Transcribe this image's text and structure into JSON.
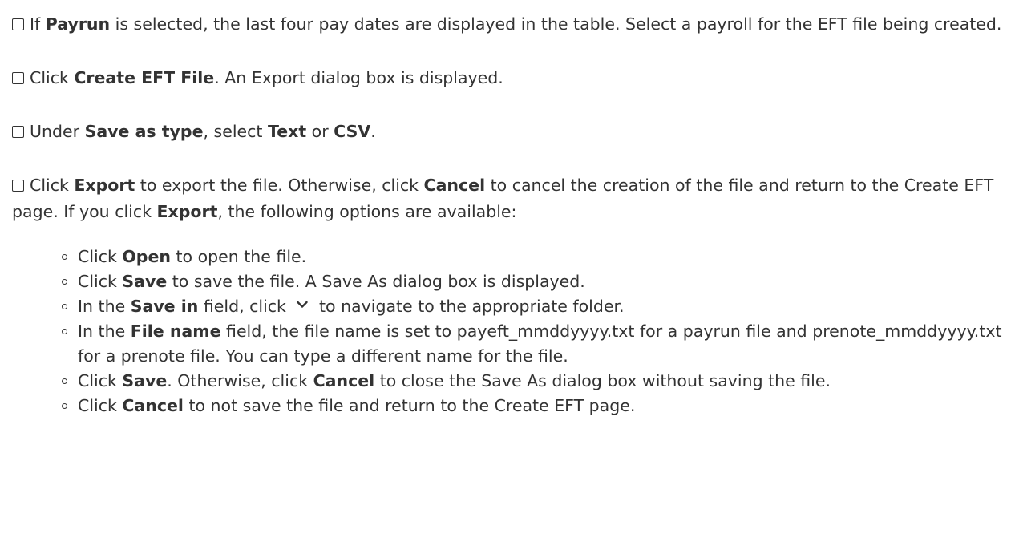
{
  "steps": [
    {
      "segments": [
        {
          "t": "If ",
          "b": false
        },
        {
          "t": "Payrun",
          "b": true
        },
        {
          "t": " is selected, the last four pay dates are displayed in the table. Select a payroll for the EFT file being created.",
          "b": false
        }
      ]
    },
    {
      "segments": [
        {
          "t": "Click ",
          "b": false
        },
        {
          "t": "Create EFT File",
          "b": true
        },
        {
          "t": ". An Export dialog box is displayed.",
          "b": false
        }
      ]
    },
    {
      "segments": [
        {
          "t": "Under ",
          "b": false
        },
        {
          "t": "Save as type",
          "b": true
        },
        {
          "t": ", select ",
          "b": false
        },
        {
          "t": "Text",
          "b": true
        },
        {
          "t": " or ",
          "b": false
        },
        {
          "t": "CSV",
          "b": true
        },
        {
          "t": ".",
          "b": false
        }
      ]
    },
    {
      "segments": [
        {
          "t": "Click ",
          "b": false
        },
        {
          "t": "Export",
          "b": true
        },
        {
          "t": " to export the file. Otherwise, click ",
          "b": false
        },
        {
          "t": "Cancel",
          "b": true
        },
        {
          "t": " to cancel the creation of the file and return to the Create EFT page. If you click ",
          "b": false
        },
        {
          "t": "Export",
          "b": true
        },
        {
          "t": ", the following options are available:",
          "b": false
        }
      ]
    }
  ],
  "options": [
    {
      "segments": [
        {
          "t": "Click ",
          "b": false
        },
        {
          "t": "Open",
          "b": true
        },
        {
          "t": " to open the file.",
          "b": false
        }
      ]
    },
    {
      "segments": [
        {
          "t": "Click ",
          "b": false
        },
        {
          "t": "Save",
          "b": true
        },
        {
          "t": " to save the file. A Save As dialog box is displayed.",
          "b": false
        }
      ]
    },
    {
      "segments": [
        {
          "t": "In the ",
          "b": false
        },
        {
          "t": "Save in",
          "b": true
        },
        {
          "t": " field, click ",
          "b": false
        },
        {
          "icon": "chevron-down-icon"
        },
        {
          "t": " to navigate to the appropriate folder.",
          "b": false
        }
      ]
    },
    {
      "segments": [
        {
          "t": "In the ",
          "b": false
        },
        {
          "t": "File name",
          "b": true
        },
        {
          "t": " field, the file name is set to payeft_mmddyyyy.txt for a payrun file and prenote_mmddyyyy.txt for a prenote file. You can type a different name for the file.",
          "b": false
        }
      ]
    },
    {
      "segments": [
        {
          "t": "Click ",
          "b": false
        },
        {
          "t": "Save",
          "b": true
        },
        {
          "t": ". Otherwise, click ",
          "b": false
        },
        {
          "t": "Cancel",
          "b": true
        },
        {
          "t": " to close the Save As dialog box without saving the file.",
          "b": false
        }
      ]
    },
    {
      "segments": [
        {
          "t": "Click ",
          "b": false
        },
        {
          "t": "Cancel",
          "b": true
        },
        {
          "t": " to not save the file and return to the Create EFT page.",
          "b": false
        }
      ]
    }
  ],
  "colors": {
    "text": "#333333",
    "background": "#ffffff"
  }
}
